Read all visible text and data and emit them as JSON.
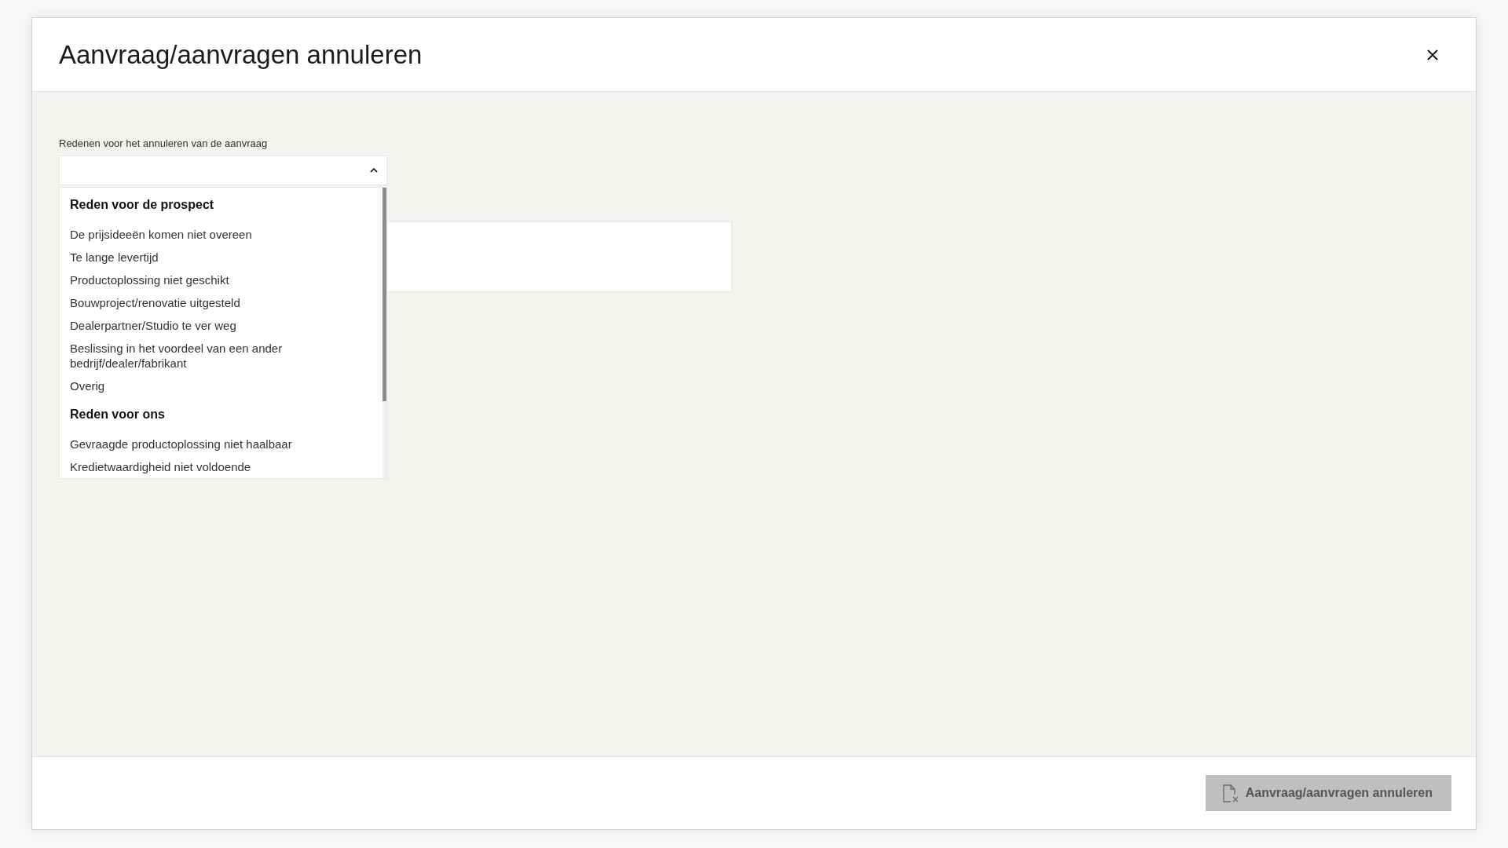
{
  "dialog": {
    "title": "Aanvraag/aanvragen annuleren"
  },
  "reason_field": {
    "label": "Redenen voor het annuleren van de aanvraag",
    "expanded": true,
    "groups": [
      {
        "heading": "Reden voor de prospect",
        "options": [
          {
            "label": "De prijsideeën komen niet overeen",
            "selected": false
          },
          {
            "label": "Te lange levertijd",
            "selected": false
          },
          {
            "label": "Productoplossing niet geschikt",
            "selected": false
          },
          {
            "label": "Bouwproject/renovatie uitgesteld",
            "selected": false
          },
          {
            "label": "Dealerpartner/Studio te ver weg",
            "selected": false
          },
          {
            "label": "Beslissing in het voordeel van een ander bedrijf/dealer/fabrikant",
            "selected": false
          },
          {
            "label": "Overig",
            "selected": false
          }
        ]
      },
      {
        "heading": "Reden voor ons",
        "options": [
          {
            "label": "Gevraagde productoplossing niet haalbaar",
            "selected": false
          },
          {
            "label": "Kredietwaardigheid niet voldoende",
            "selected": false
          }
        ]
      }
    ]
  },
  "actions": [
    {
      "label": "Aanvraag/aanvragen annuleren",
      "disabled": true
    }
  ]
}
